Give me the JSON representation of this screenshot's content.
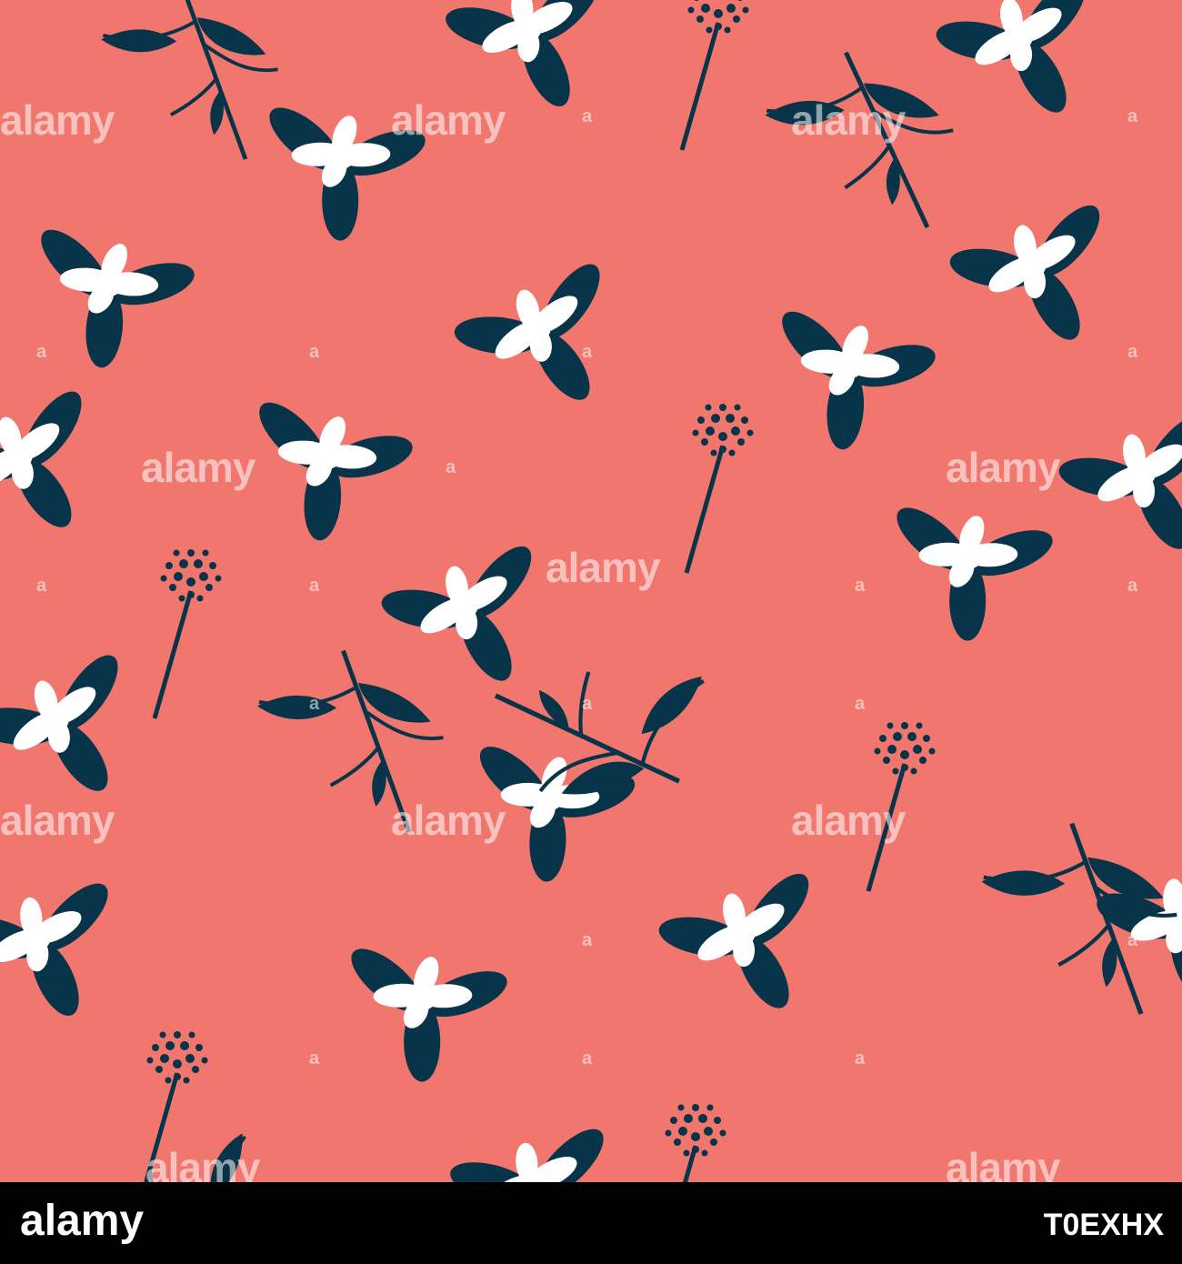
{
  "pattern": {
    "background_color": "#F0766E",
    "ink_color": "#073449",
    "petal_color": "#FFFFFF"
  },
  "watermark": {
    "brand": "alamy",
    "short": "a"
  },
  "footer": {
    "logo_text": "alamy",
    "image_id": "T0EXHX",
    "background_color": "#000000"
  }
}
